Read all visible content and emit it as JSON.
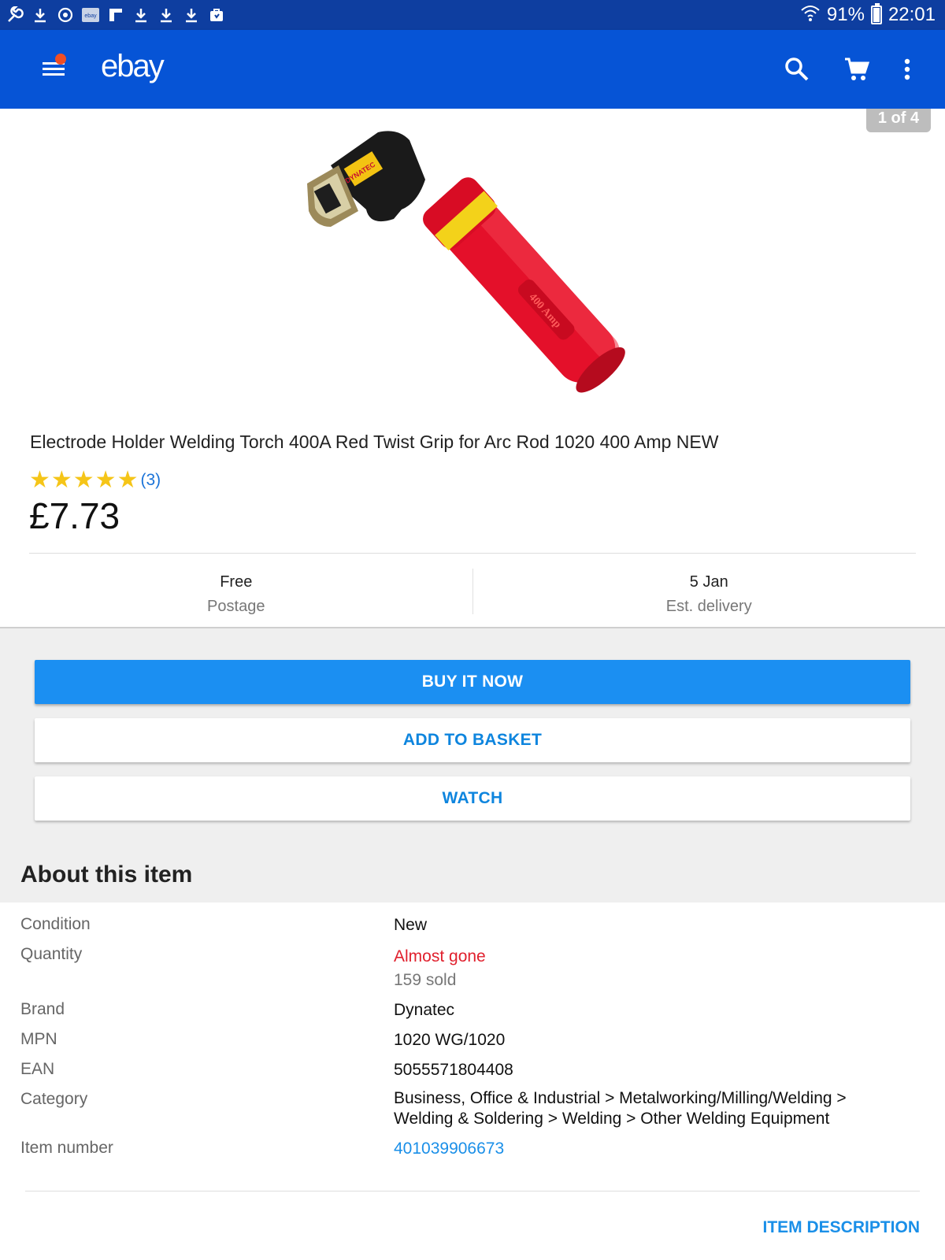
{
  "status_bar": {
    "battery": "91%",
    "time": "22:01",
    "battery_level": 0.91
  },
  "header": {
    "logo": "ebay"
  },
  "gallery": {
    "counter": "1 of 4",
    "image_labels": {
      "brand_tag": "DYNATEC",
      "handle_text": "400 Amp"
    }
  },
  "product": {
    "title": "Electrode Holder Welding Torch 400A Red Twist Grip for Arc Rod 1020 400 Amp NEW",
    "stars": "★★★★★",
    "rating_value": 5,
    "rating_count": "(3)",
    "price": "£7.73"
  },
  "delivery": {
    "postage_value": "Free",
    "postage_label": "Postage",
    "delivery_value": "5 Jan",
    "delivery_label": "Est. delivery"
  },
  "actions": {
    "buy_now": "BUY IT NOW",
    "add_to_basket": "ADD TO BASKET",
    "watch": "WATCH"
  },
  "about": {
    "title": "About this item",
    "rows": {
      "condition": {
        "label": "Condition",
        "value": "New"
      },
      "quantity": {
        "label": "Quantity",
        "value": "Almost gone",
        "sub": "159 sold"
      },
      "brand": {
        "label": "Brand",
        "value": "Dynatec"
      },
      "mpn": {
        "label": "MPN",
        "value": "1020 WG/1020"
      },
      "ean": {
        "label": "EAN",
        "value": "5055571804408"
      },
      "category": {
        "label": "Category",
        "value": "Business, Office & Industrial > Metalworking/Milling/Welding > Welding & Soldering > Welding > Other Welding Equipment"
      },
      "item_number": {
        "label": "Item number",
        "value": "401039906673"
      }
    },
    "item_description": "ITEM DESCRIPTION"
  },
  "colors": {
    "status_bar": "#0e3ea0",
    "app_bar": "#0654d6",
    "primary_button": "#1b8ff2",
    "link": "#1a8fe8",
    "alert_red": "#e0202d",
    "star": "#f5c518"
  }
}
